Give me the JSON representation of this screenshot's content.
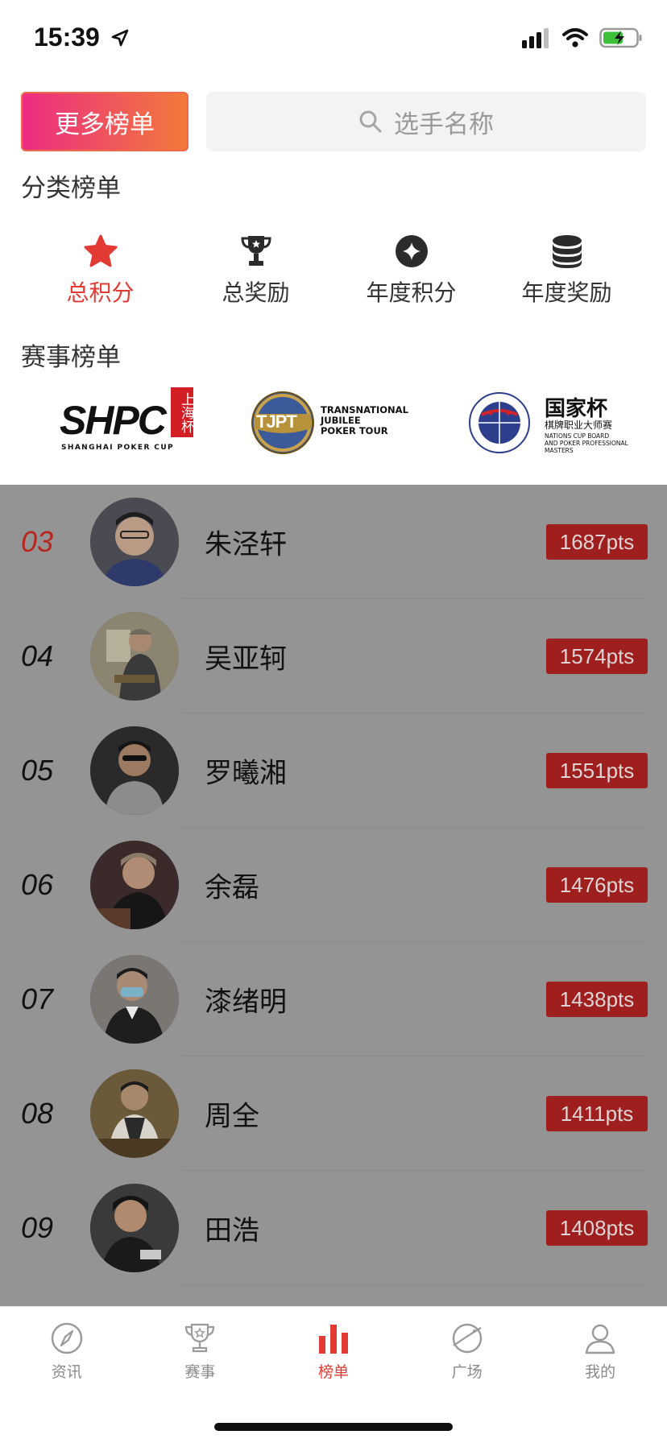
{
  "status_bar": {
    "time": "15:39"
  },
  "header": {
    "more_button": "更多榜单",
    "search_placeholder": "选手名称"
  },
  "categories": {
    "title": "分类榜单",
    "items": [
      {
        "label": "总积分",
        "icon": "star-icon",
        "active": true
      },
      {
        "label": "总奖励",
        "icon": "trophy-icon",
        "active": false
      },
      {
        "label": "年度积分",
        "icon": "diamond-icon",
        "active": false
      },
      {
        "label": "年度奖励",
        "icon": "coins-icon",
        "active": false
      }
    ]
  },
  "events": {
    "title": "赛事榜单",
    "logos": [
      {
        "name": "SHPC",
        "side_text": "上海杯",
        "caption": "SHANGHAI POKER CUP"
      },
      {
        "name": "TJPT",
        "line1": "TRANSNATIONAL",
        "line2": "JUBILEE",
        "line3": "POKER TOUR"
      },
      {
        "name": "国家杯",
        "sub": "棋牌职业大师赛",
        "line1": "NATIONS CUP BOARD",
        "line2": "AND POKER PROFESSIONAL",
        "line3": "MASTERS"
      }
    ]
  },
  "ranking": [
    {
      "rank": "03",
      "name": "朱泾轩",
      "pts": "1687pts"
    },
    {
      "rank": "04",
      "name": "吴亚轲",
      "pts": "1574pts"
    },
    {
      "rank": "05",
      "name": "罗曦湘",
      "pts": "1551pts"
    },
    {
      "rank": "06",
      "name": "余磊",
      "pts": "1476pts"
    },
    {
      "rank": "07",
      "name": "漆绪明",
      "pts": "1438pts"
    },
    {
      "rank": "08",
      "name": "周全",
      "pts": "1411pts"
    },
    {
      "rank": "09",
      "name": "田浩",
      "pts": "1408pts"
    }
  ],
  "tab_bar": {
    "tabs": [
      {
        "label": "资讯",
        "icon": "compass-icon",
        "active": false
      },
      {
        "label": "赛事",
        "icon": "trophy-icon",
        "active": false
      },
      {
        "label": "榜单",
        "icon": "bar-chart-icon",
        "active": true
      },
      {
        "label": "广场",
        "icon": "planet-icon",
        "active": false
      },
      {
        "label": "我的",
        "icon": "user-icon",
        "active": false
      }
    ]
  },
  "colors": {
    "accent": "#e23b33",
    "pts_badge": "#9f1f1f",
    "overlay": "#949494"
  }
}
